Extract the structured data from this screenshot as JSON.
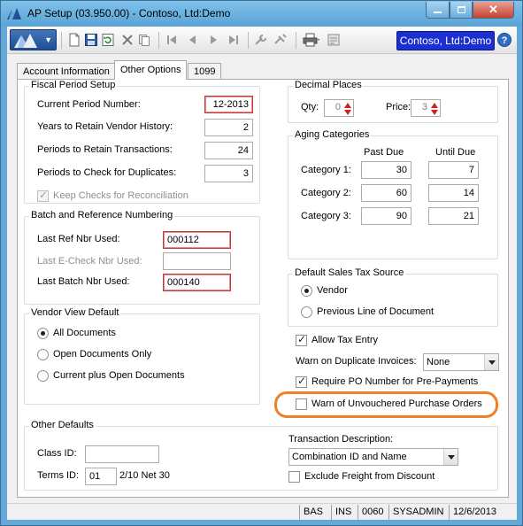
{
  "window": {
    "title": "AP Setup (03.950.00) - Contoso, Ltd:Demo"
  },
  "toolbar": {
    "company_label": "Contoso, Ltd:Demo",
    "help_label": "?"
  },
  "tabs": [
    {
      "label": "Account Information"
    },
    {
      "label": "Other Options",
      "selected": true
    },
    {
      "label": "1099"
    }
  ],
  "fiscal": {
    "title": "Fiscal Period Setup",
    "current_period_label": "Current Period Number:",
    "current_period_value": "12-2013",
    "years_retain_label": "Years to Retain Vendor History:",
    "years_retain_value": "2",
    "periods_retain_label": "Periods to Retain Transactions:",
    "periods_retain_value": "24",
    "periods_check_label": "Periods to Check for Duplicates:",
    "periods_check_value": "3",
    "keep_checks_label": "Keep Checks for Reconciliation"
  },
  "batch": {
    "title": "Batch and Reference Numbering",
    "last_ref_label": "Last Ref Nbr Used:",
    "last_ref_value": "000112",
    "last_echeck_label": "Last E-Check Nbr Used:",
    "last_echeck_value": "",
    "last_batch_label": "Last Batch Nbr Used:",
    "last_batch_value": "000140"
  },
  "vendor_view": {
    "title": "Vendor View Default",
    "options": [
      "All Documents",
      "Open Documents Only",
      "Current plus Open Documents"
    ],
    "selected_index": 0
  },
  "decimal": {
    "title": "Decimal Places",
    "qty_label": "Qty:",
    "qty_value": "0",
    "price_label": "Price:",
    "price_value": "3"
  },
  "aging": {
    "title": "Aging Categories",
    "past_due_header": "Past Due",
    "until_due_header": "Until Due",
    "rows": [
      {
        "label": "Category 1:",
        "past_due": "30",
        "until_due": "7"
      },
      {
        "label": "Category 2:",
        "past_due": "60",
        "until_due": "14"
      },
      {
        "label": "Category 3:",
        "past_due": "90",
        "until_due": "21"
      }
    ]
  },
  "sales_tax": {
    "title": "Default Sales Tax Source",
    "options": [
      "Vendor",
      "Previous Line of Document"
    ],
    "selected_index": 0
  },
  "options": {
    "allow_tax_entry_label": "Allow Tax Entry",
    "allow_tax_entry_checked": true,
    "warn_duplicate_label": "Warn on Duplicate Invoices:",
    "warn_duplicate_value": "None",
    "require_po_label": "Require PO Number for Pre-Payments",
    "require_po_checked": true,
    "warn_unvouchered_label": "Warn of Unvouchered Purchase Orders",
    "warn_unvouchered_checked": false
  },
  "other_defaults": {
    "title": "Other Defaults",
    "class_id_label": "Class ID:",
    "class_id_value": "",
    "terms_id_label": "Terms ID:",
    "terms_id_value": "01",
    "terms_desc": "2/10 Net 30",
    "trans_desc_label": "Transaction Description:",
    "trans_desc_value": "Combination ID and Name",
    "exclude_freight_label": "Exclude Freight from Discount",
    "exclude_freight_checked": false
  },
  "status": {
    "mode": "BAS",
    "ins": "INS",
    "code": "0060",
    "user": "SYSADMIN",
    "date": "12/6/2013"
  },
  "colors": {
    "title_bar": "#5aa3d6",
    "company_button": "#1c2fd0",
    "required_border": "#c33a3a",
    "highlight": "#f07f25"
  }
}
